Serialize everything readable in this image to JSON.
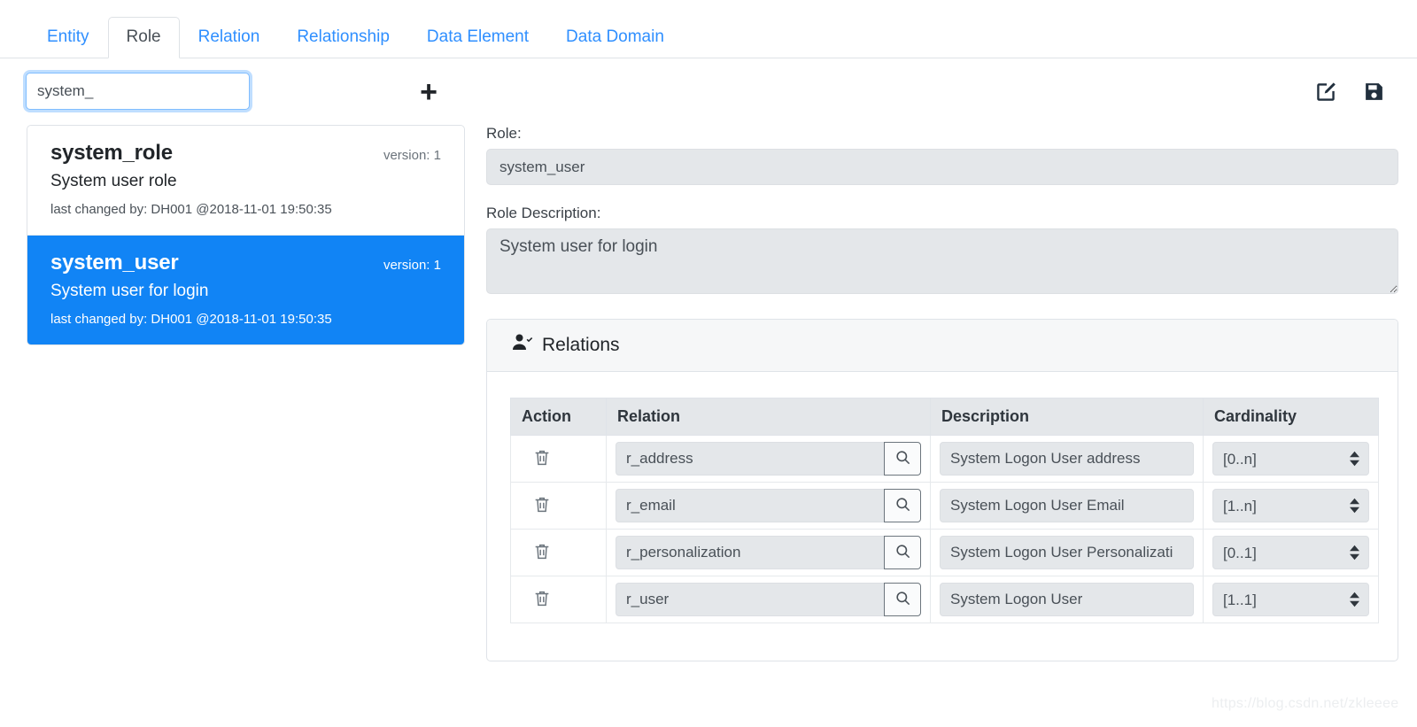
{
  "tabs": [
    {
      "label": "Entity",
      "active": false
    },
    {
      "label": "Role",
      "active": true
    },
    {
      "label": "Relation",
      "active": false
    },
    {
      "label": "Relationship",
      "active": false
    },
    {
      "label": "Data Element",
      "active": false
    },
    {
      "label": "Data Domain",
      "active": false
    }
  ],
  "toolbar": {
    "search_value": "system_",
    "search_placeholder": "",
    "add_label": "+",
    "edit_icon": "edit-pencil-square-icon",
    "save_icon": "floppy-disk-save-icon"
  },
  "list": [
    {
      "title": "system_role",
      "version": "version: 1",
      "description": "System user role",
      "meta": "last changed by: DH001 @2018-11-01 19:50:35",
      "selected": false
    },
    {
      "title": "system_user",
      "version": "version: 1",
      "description": "System user for login",
      "meta": "last changed by: DH001 @2018-11-01 19:50:35",
      "selected": true
    }
  ],
  "detail": {
    "role_label": "Role:",
    "role_value": "system_user",
    "role_description_label": "Role Description:",
    "role_description_value": "System user for login"
  },
  "relations_card": {
    "title": "Relations",
    "icon": "user-check-icon",
    "columns": [
      "Action",
      "Relation",
      "Description",
      "Cardinality"
    ],
    "rows": [
      {
        "action_icon": "trash-icon",
        "relation": "r_address",
        "lookup_icon": "search-icon",
        "description": "System Logon User address",
        "cardinality": "[0..n]"
      },
      {
        "action_icon": "trash-icon",
        "relation": "r_email",
        "lookup_icon": "search-icon",
        "description": "System Logon User Email",
        "cardinality": "[1..n]"
      },
      {
        "action_icon": "trash-icon",
        "relation": "r_personalization",
        "lookup_icon": "search-icon",
        "description": "System Logon User Personalizati",
        "cardinality": "[0..1]"
      },
      {
        "action_icon": "trash-icon",
        "relation": "r_user",
        "lookup_icon": "search-icon",
        "description": "System Logon User",
        "cardinality": "[1..1]"
      }
    ]
  },
  "watermark": "https://blog.csdn.net/zkleeee",
  "colors": {
    "tab_link": "#2f8fff",
    "selected_row": "#1184f5",
    "field_bg": "#e4e7ea",
    "border": "#dee2e6"
  }
}
